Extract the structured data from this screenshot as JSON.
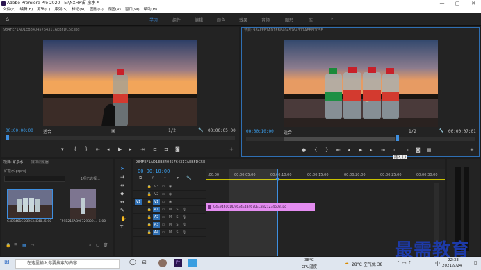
{
  "window": {
    "title": "Adobe Premiere Pro 2020 - E:\\NXHR\\矿泉水 *",
    "min": "—",
    "max": "▢",
    "close": "✕"
  },
  "menu": [
    "文件(F)",
    "编辑(E)",
    "剪辑(C)",
    "序列(S)",
    "标记(M)",
    "图形(G)",
    "视图(V)",
    "窗口(W)",
    "帮助(H)"
  ],
  "workspaces": [
    "学习",
    "组件",
    "编辑",
    "颜色",
    "效果",
    "音频",
    "图形",
    "库"
  ],
  "workspace_more": "»",
  "source": {
    "title": "984FEF1AD1EB84045764317AEBFDC5E.jpg",
    "timecode": "00:00:00:00",
    "fit": "适合",
    "ratio": "1/2",
    "duration": "00:00:05:00"
  },
  "program": {
    "title": "节目: 984FEF1AD1EB84045764317AEBFDC5E",
    "timecode": "00:00:10:00",
    "fit": "适合",
    "ratio": "1/2",
    "duration": "00:00:07:01",
    "tooltip": "插入 (,)"
  },
  "project": {
    "tab1": "项目: 矿泉水",
    "tab2": "媒体浏览器",
    "file": "矿泉水.prproj",
    "selected": "1项已选择...",
    "items": [
      {
        "name": "C4E9461CDD9634E48...",
        "dur": "5:00"
      },
      {
        "name": "F59B216AB9F729309...",
        "dur": "5:00"
      }
    ]
  },
  "timeline": {
    "title": "984FEF1AD1EB84045764317AEBFDC5E",
    "timecode": "00:00:10:00",
    "ruler": [
      ":00:00",
      "00:00:05:00",
      "00:00:10:00",
      "00:00:15:00",
      "00:00:20:00",
      "00:00:25:00",
      "00:00:30:00"
    ],
    "clip": "C4E9461CDD9634E484670EC3B21234608.jpg",
    "tracks": [
      "V3",
      "V2",
      "V1",
      "A1",
      "A2",
      "A3",
      "A4"
    ],
    "track_buttons": [
      "M",
      "S"
    ]
  },
  "watermark": "最需教育",
  "taskbar": {
    "search": "在这里输入你要搜索的内容",
    "temp": "38°C",
    "cpu": "CPU温度",
    "weather": "28°C 空气优 38",
    "time": "22:33",
    "date": "2021/9/24",
    "lang": "中"
  },
  "accent": "#3e8fe0",
  "clip_color": "#e38cf0"
}
